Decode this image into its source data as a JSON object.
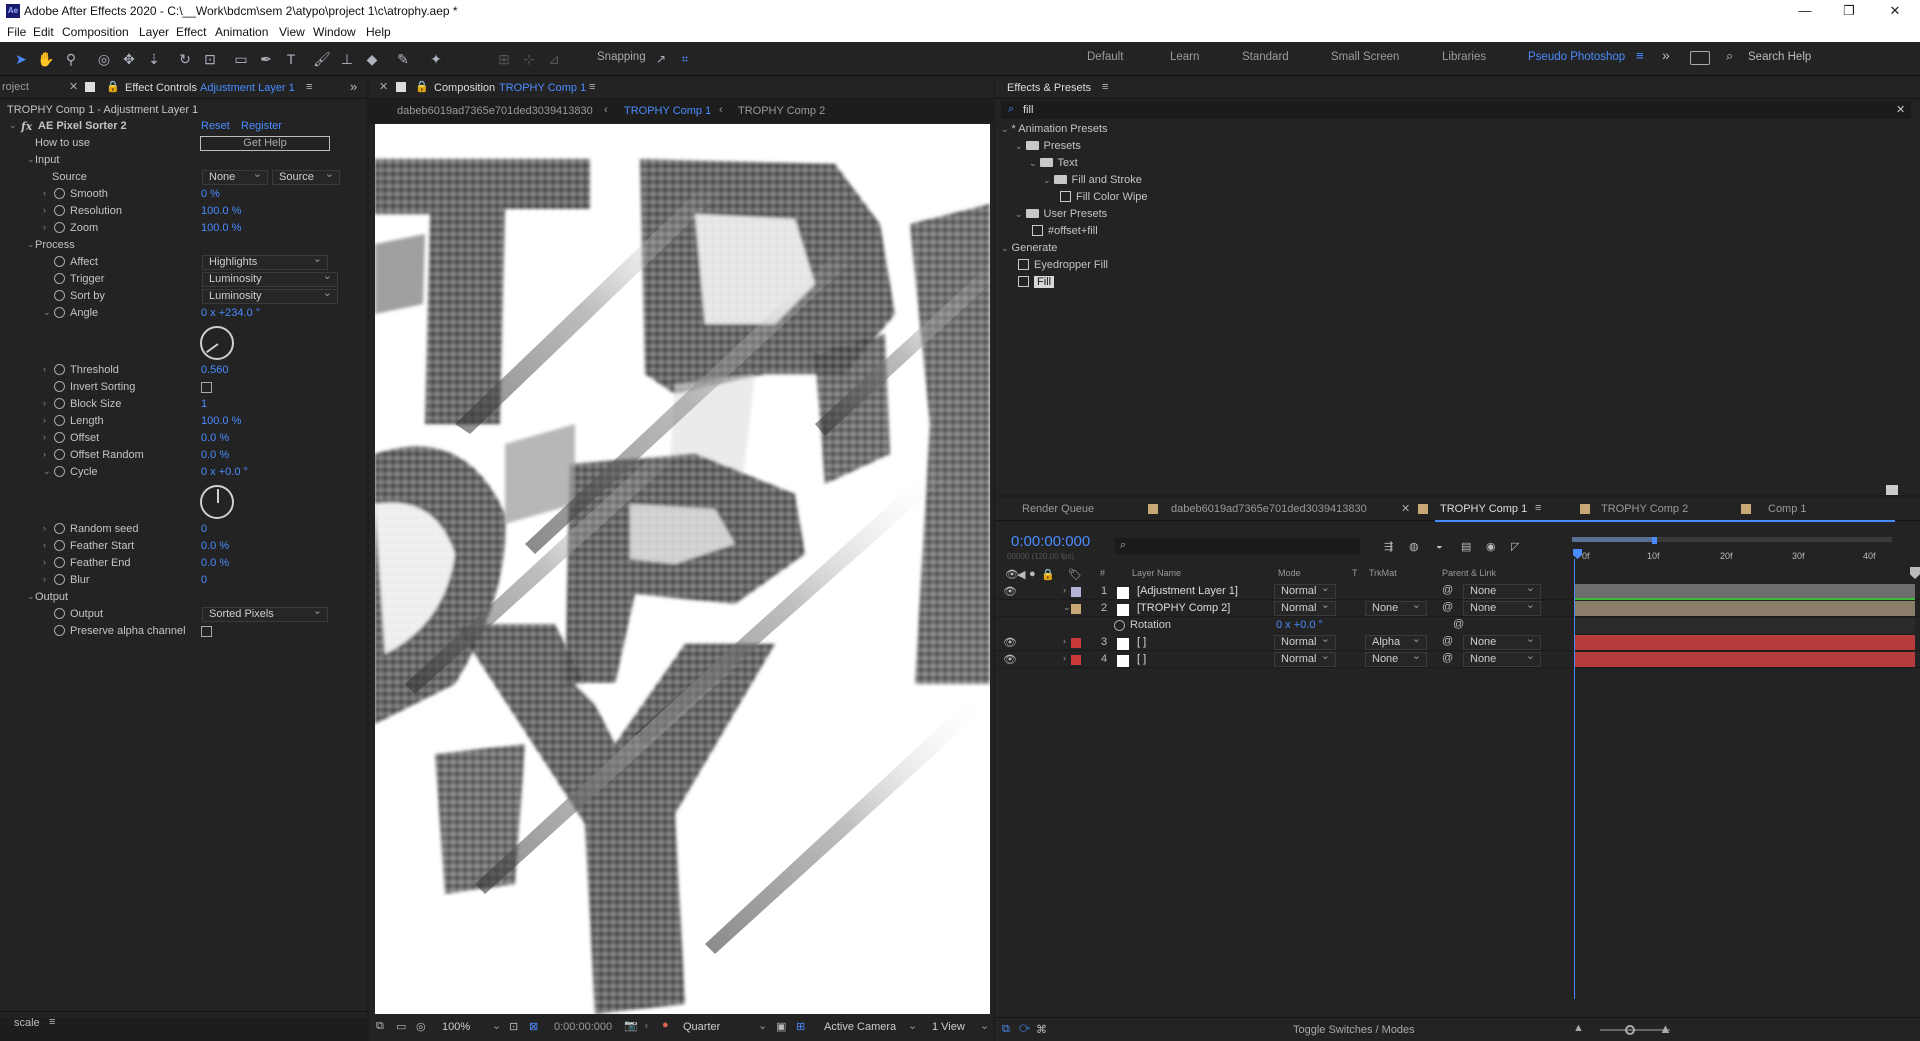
{
  "title_bar": {
    "app_icon": "Ae",
    "title": "Adobe After Effects 2020 - C:\\__Work\\bdcm\\sem 2\\atypo\\project 1\\c\\atrophy.aep *",
    "minimize": "—",
    "restore": "❐",
    "close": "✕"
  },
  "menu": [
    "File",
    "Edit",
    "Composition",
    "Layer",
    "Effect",
    "Animation",
    "View",
    "Window",
    "Help"
  ],
  "toolbar": {
    "snapping_label": "Snapping",
    "workspaces": [
      "Default",
      "Learn",
      "Standard",
      "Small Screen",
      "Libraries",
      "Pseudo Photoshop"
    ],
    "active_workspace": "Pseudo Photoshop",
    "search_placeholder": "Search Help",
    "overflow": "»"
  },
  "project_panel": {
    "tab": "roject",
    "footer_label": "scale"
  },
  "effect_controls": {
    "tab_prefix": "Effect Controls",
    "tab_layer": "Adjustment Layer 1",
    "breadcrumb": "TROPHY Comp 1 - Adjustment Layer 1",
    "effect_name": "AE Pixel Sorter 2",
    "reset": "Reset",
    "register": "Register",
    "how_to_use": "How to use",
    "get_help": "Get Help",
    "groups": {
      "input": "Input",
      "process": "Process",
      "output": "Output"
    },
    "source": {
      "label": "Source",
      "dd1": "None",
      "dd2": "Source"
    },
    "smooth": {
      "label": "Smooth",
      "value": "0 %"
    },
    "resolution": {
      "label": "Resolution",
      "value": "100.0 %"
    },
    "zoom": {
      "label": "Zoom",
      "value": "100.0 %"
    },
    "affect": {
      "label": "Affect",
      "value": "Highlights"
    },
    "trigger": {
      "label": "Trigger",
      "value": "Luminosity"
    },
    "sort_by": {
      "label": "Sort by",
      "value": "Luminosity"
    },
    "angle": {
      "label": "Angle",
      "value": "0 x +234.0 °",
      "degrees": 234
    },
    "threshold": {
      "label": "Threshold",
      "value": "0.560"
    },
    "invert_sorting": {
      "label": "Invert Sorting",
      "checked": false
    },
    "block_size": {
      "label": "Block Size",
      "value": "1"
    },
    "length": {
      "label": "Length",
      "value": "100.0 %"
    },
    "offset": {
      "label": "Offset",
      "value": "0.0 %"
    },
    "offset_random": {
      "label": "Offset Random",
      "value": "0.0 %"
    },
    "cycle": {
      "label": "Cycle",
      "value": "0 x +0.0 °",
      "degrees": 0
    },
    "random_seed": {
      "label": "Random seed",
      "value": "0"
    },
    "feather_start": {
      "label": "Feather Start",
      "value": "0.0 %"
    },
    "feather_end": {
      "label": "Feather End",
      "value": "0.0 %"
    },
    "blur": {
      "label": "Blur",
      "value": "0"
    },
    "output": {
      "label": "Output",
      "value": "Sorted Pixels"
    },
    "preserve_alpha": {
      "label": "Preserve alpha channel",
      "checked": false
    }
  },
  "composition": {
    "tab_prefix": "Composition",
    "tab_comp": "TROPHY Comp 1",
    "crumbs": [
      "dabeb6019ad7365e701ded3039413830",
      "TROPHY Comp 1",
      "TROPHY Comp 2"
    ],
    "footer": {
      "zoom": "100%",
      "timecode": "0:00:00:000",
      "resolution": "Quarter",
      "camera": "Active Camera",
      "views": "1 View"
    }
  },
  "effects_presets": {
    "title": "Effects & Presets",
    "search_value": "fill",
    "tree": [
      {
        "label": "* Animation Presets",
        "depth": 0,
        "kind": "group"
      },
      {
        "label": "Presets",
        "depth": 1,
        "kind": "folder"
      },
      {
        "label": "Text",
        "depth": 2,
        "kind": "folder"
      },
      {
        "label": "Fill and Stroke",
        "depth": 3,
        "kind": "folder"
      },
      {
        "label": "Fill Color Wipe",
        "depth": 4,
        "kind": "preset"
      },
      {
        "label": "User Presets",
        "depth": 1,
        "kind": "folder"
      },
      {
        "label": "#offset+fill",
        "depth": 2,
        "kind": "preset"
      },
      {
        "label": "Generate",
        "depth": 0,
        "kind": "group"
      },
      {
        "label": "Eyedropper Fill",
        "depth": 1,
        "kind": "preset"
      },
      {
        "label": "Fill",
        "depth": 1,
        "kind": "preset-selected"
      }
    ]
  },
  "timeline": {
    "tabs": [
      "Render Queue",
      "dabeb6019ad7365e701ded3039413830",
      "TROPHY Comp 1",
      "TROPHY Comp 2",
      "Comp 1"
    ],
    "active_tab": "TROPHY Comp 1",
    "timecode": "0:00:00:000",
    "timecode_sub": "00000 (120.00 fps)",
    "columns": {
      "num": "#",
      "layer_name": "Layer Name",
      "mode": "Mode",
      "t": "T",
      "trkmat": "TrkMat",
      "parent": "Parent & Link"
    },
    "ruler": [
      "0f",
      "10f",
      "20f",
      "30f",
      "40f"
    ],
    "layers": [
      {
        "num": "1",
        "name": "[Adjustment Layer 1]",
        "mode": "Normal",
        "trkmat": "",
        "parent": "None",
        "label_color": "#b4b2d8",
        "bar_color": "#6e6e6e",
        "visible": true
      },
      {
        "num": "2",
        "name": "[TROPHY Comp 2]",
        "mode": "Normal",
        "trkmat": "None",
        "parent": "None",
        "label_color": "#c9a877",
        "bar_color": "#8a7d6a",
        "visible": false
      },
      {
        "num": "3",
        "name": "[ ]",
        "mode": "Normal",
        "trkmat": "Alpha",
        "parent": "None",
        "label_color": "#c93a3a",
        "bar_color": "#b43c3c",
        "visible": true
      },
      {
        "num": "4",
        "name": "[ ]",
        "mode": "Normal",
        "trkmat": "None",
        "parent": "None",
        "label_color": "#c93a3a",
        "bar_color": "#b43c3c",
        "visible": true
      }
    ],
    "rotation": {
      "label": "Rotation",
      "value": "0 x +0.0 °"
    },
    "footer": "Toggle Switches / Modes"
  },
  "colors": {
    "accent": "#4a8cff",
    "panel": "#232323",
    "bg": "#1d1d1d"
  }
}
